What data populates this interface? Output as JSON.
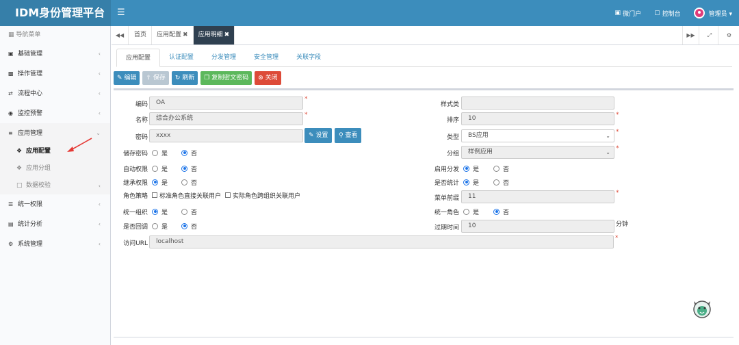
{
  "app": {
    "title": "IDM身份管理平台"
  },
  "topnav": {
    "portal": "微门户",
    "console": "控制台",
    "user": "管理员 ▾"
  },
  "sidebar": {
    "header": "导航菜单",
    "items": [
      {
        "label": "基础管理"
      },
      {
        "label": "操作管理"
      },
      {
        "label": "流程中心"
      },
      {
        "label": "监控预警"
      },
      {
        "label": "应用管理"
      }
    ],
    "subitems": [
      {
        "label": "应用配置"
      },
      {
        "label": "应用分组"
      },
      {
        "label": "数据校验"
      }
    ],
    "items2": [
      {
        "label": "统一权限"
      },
      {
        "label": "统计分析"
      },
      {
        "label": "系统管理"
      }
    ]
  },
  "tabs": [
    {
      "label": "首页"
    },
    {
      "label": "应用配置"
    },
    {
      "label": "应用明细"
    }
  ],
  "subtabs": [
    {
      "label": "应用配置"
    },
    {
      "label": "认证配置"
    },
    {
      "label": "分发管理"
    },
    {
      "label": "安全管理"
    },
    {
      "label": "关联字段"
    }
  ],
  "toolbar": {
    "edit": "编辑",
    "save": "保存",
    "refresh": "刷新",
    "copy_secret": "复制密文密码",
    "close": "关闭"
  },
  "form": {
    "code": {
      "label": "编码",
      "value": "OA"
    },
    "name": {
      "label": "名称",
      "value": "综合办公系统"
    },
    "password": {
      "label": "密码",
      "value": "xxxx",
      "set": "设置",
      "view": "查看"
    },
    "store_password": {
      "label": "储存密码",
      "yes": "是",
      "no": "否"
    },
    "auto_perm": {
      "label": "自动权限",
      "yes": "是",
      "no": "否"
    },
    "inherit_perm": {
      "label": "继承权限",
      "yes": "是",
      "no": "否"
    },
    "role_policy": {
      "label": "角色策略",
      "opt1": "标准角色直接关联用户",
      "opt2": "实际角色跨组织关联用户"
    },
    "unify_org": {
      "label": "统一组织",
      "yes": "是",
      "no": "否"
    },
    "callback": {
      "label": "是否回调",
      "yes": "是",
      "no": "否"
    },
    "url": {
      "label": "访问URL",
      "value": "localhost"
    },
    "style": {
      "label": "样式类",
      "value": ""
    },
    "order": {
      "label": "排序",
      "value": "10"
    },
    "type": {
      "label": "类型",
      "value": "BS应用"
    },
    "group": {
      "label": "分组",
      "value": "样例应用"
    },
    "app_dist": {
      "label": "启用分发",
      "yes": "是",
      "no": "否"
    },
    "stats": {
      "label": "是否统计",
      "yes": "是",
      "no": "否"
    },
    "menu_prefix": {
      "label": "菜单前缀",
      "value": "11"
    },
    "unify_role": {
      "label": "统一角色",
      "yes": "是",
      "no": "否"
    },
    "expire": {
      "label": "过期时间",
      "value": "10",
      "unit": "分钟"
    }
  },
  "colors": {
    "brand": "#3c8dbc",
    "logo_bg": "#367fa9",
    "danger": "#dd4b39",
    "success": "#5cb85c",
    "radio": "#1a73e8"
  },
  "icons": {
    "menu": "hamburger-icon",
    "portal": "id-card-icon",
    "console": "monitor-icon",
    "arrow": "red-arrow-annotation"
  }
}
